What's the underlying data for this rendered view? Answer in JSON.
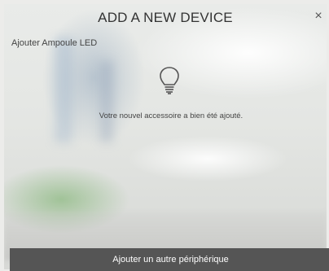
{
  "dialog": {
    "title": "ADD A NEW DEVICE",
    "close_glyph": "×",
    "close_icon": "close-icon"
  },
  "device": {
    "name": "Ajouter Ampoule LED",
    "icon": "lightbulb-icon"
  },
  "message": "Votre nouvel accessoire a bien été ajouté.",
  "footer": {
    "add_another_label": "Ajouter un autre périphérique"
  },
  "colors": {
    "footer_bg": "#555555",
    "footer_text": "#ffffff",
    "title_text": "#333333"
  }
}
